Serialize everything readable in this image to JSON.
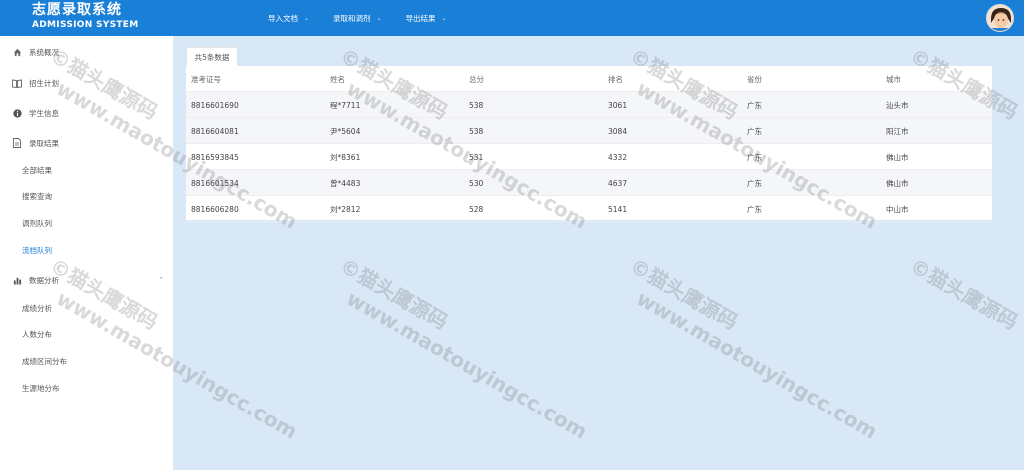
{
  "header": {
    "title": "志愿录取系统",
    "subtitle": "ADMISSION SYSTEM",
    "menu": [
      {
        "label": "导入文档",
        "has_dropdown": true
      },
      {
        "label": "录取和调剂",
        "has_dropdown": true
      },
      {
        "label": "导出结果",
        "has_dropdown": true
      }
    ],
    "bg_color": "#1a7fd6"
  },
  "sidebar": {
    "items": [
      {
        "label": "系统概况",
        "icon": "home-icon"
      },
      {
        "label": "招生计划",
        "icon": "book-icon"
      },
      {
        "label": "学生信息",
        "icon": "info-icon"
      },
      {
        "label": "录取结果",
        "icon": "document-icon"
      }
    ],
    "results_sub": [
      {
        "label": "全部结果"
      },
      {
        "label": "搜索查询"
      },
      {
        "label": "调剂队列"
      },
      {
        "label": "流档队列",
        "active": true
      }
    ],
    "analysis": {
      "label": "数据分析",
      "icon": "bar-chart-icon",
      "expanded": true
    },
    "analysis_sub": [
      {
        "label": "成绩分析"
      },
      {
        "label": "人数分布"
      },
      {
        "label": "成绩区间分布"
      },
      {
        "label": "生源地分布"
      }
    ],
    "active_color": "#1a7fd6"
  },
  "table": {
    "tab_label": "共5条数据",
    "columns": [
      "准考证号",
      "姓名",
      "总分",
      "排名",
      "省份",
      "城市"
    ],
    "rows": [
      [
        "8816601690",
        "程*7711",
        "538",
        "3061",
        "广东",
        "汕头市"
      ],
      [
        "8816604081",
        "尹*5604",
        "538",
        "3084",
        "广东",
        "阳江市"
      ],
      [
        "8816593845",
        "刘*8361",
        "531",
        "4332",
        "广东",
        "佛山市"
      ],
      [
        "8816601534",
        "曾*4483",
        "530",
        "4637",
        "广东",
        "佛山市"
      ],
      [
        "8816606280",
        "刘*2812",
        "528",
        "5141",
        "广东",
        "中山市"
      ]
    ]
  },
  "watermark": {
    "line1": "©猫头鹰源码",
    "line2": "www.maotouyingcc.com"
  }
}
